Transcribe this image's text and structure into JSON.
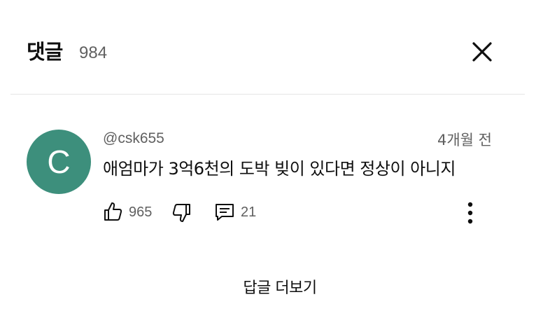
{
  "header": {
    "title": "댓글",
    "count": "984",
    "close_icon": "close-icon"
  },
  "comment": {
    "avatar_letter": "C",
    "avatar_color": "#3d8f7c",
    "handle": "@csk655",
    "time": "4개월 전",
    "text": "애엄마가 3억6천의 도박 빚이 있다면 정상이 아니지",
    "actions": {
      "like_icon": "thumbs-up-icon",
      "like_count": "965",
      "dislike_icon": "thumbs-down-icon",
      "reply_icon": "comment-icon",
      "reply_count": "21",
      "more_icon": "more-vertical-icon"
    }
  },
  "footer": {
    "more_replies": "답글 더보기"
  }
}
